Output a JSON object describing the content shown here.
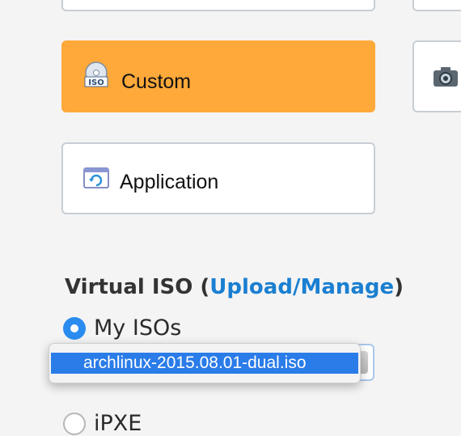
{
  "cards": {
    "custom": {
      "label": "Custom",
      "selected": true
    },
    "application": {
      "label": "Application",
      "selected": false
    }
  },
  "virtual_iso": {
    "title_prefix": "Virtual ISO (",
    "link_label": "Upload/Manage",
    "title_suffix": ")",
    "options": {
      "my_isos": {
        "label": "My ISOs",
        "checked": true
      },
      "ipxe": {
        "label": "iPXE",
        "checked": false
      }
    },
    "selected_iso": "archlinux-2015.08.01-dual.iso"
  },
  "colors": {
    "selected_card": "#ffa93a",
    "link": "#1a7fd1",
    "radio_checked": "#2b8cf0",
    "dropdown_highlight": "#2a7ce8"
  }
}
